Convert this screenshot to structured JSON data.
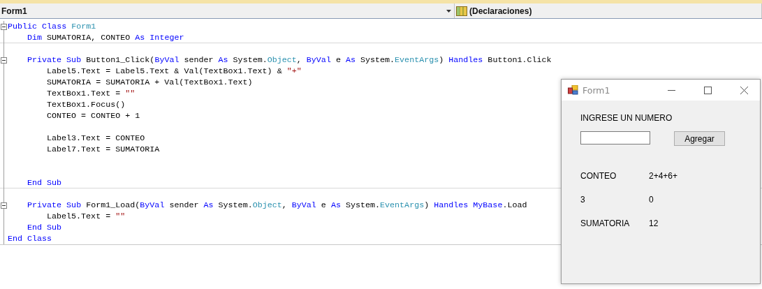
{
  "editor": {
    "class_dropdown": "Form1",
    "member_dropdown": "(Declaraciones)",
    "code": [
      {
        "kind": "code",
        "expanded": true,
        "tokens": [
          {
            "kind": "keyword",
            "text": "Public Class "
          },
          {
            "kind": "type",
            "text": "Form1"
          }
        ],
        "children": [
          {
            "kind": "code",
            "separator_after": true,
            "tokens": [
              {
                "kind": "keyword",
                "text": "Dim "
              },
              {
                "kind": "plain",
                "text": "SUMATORIA, CONTEO "
              },
              {
                "kind": "keyword",
                "text": "As Integer"
              }
            ]
          },
          {
            "kind": "blank"
          },
          {
            "kind": "code",
            "expanded": true,
            "tokens": [
              {
                "kind": "keyword",
                "text": "Private Sub "
              },
              {
                "kind": "plain",
                "text": "Button1_Click("
              },
              {
                "kind": "keyword",
                "text": "ByVal"
              },
              {
                "kind": "plain",
                "text": " sender "
              },
              {
                "kind": "keyword",
                "text": "As"
              },
              {
                "kind": "plain",
                "text": " System."
              },
              {
                "kind": "type",
                "text": "Object"
              },
              {
                "kind": "plain",
                "text": ", "
              },
              {
                "kind": "keyword",
                "text": "ByVal"
              },
              {
                "kind": "plain",
                "text": " e "
              },
              {
                "kind": "keyword",
                "text": "As"
              },
              {
                "kind": "plain",
                "text": " System."
              },
              {
                "kind": "type",
                "text": "EventArgs"
              },
              {
                "kind": "plain",
                "text": ") "
              },
              {
                "kind": "keyword",
                "text": "Handles"
              },
              {
                "kind": "plain",
                "text": " Button1.Click"
              }
            ],
            "children": [
              {
                "kind": "code",
                "tokens": [
                  {
                    "kind": "plain",
                    "text": "Label5.Text = Label5.Text & Val(TextBox1.Text) & "
                  },
                  {
                    "kind": "string",
                    "text": "\"+\""
                  }
                ]
              },
              {
                "kind": "code",
                "tokens": [
                  {
                    "kind": "plain",
                    "text": "SUMATORIA = SUMATORIA + Val(TextBox1.Text)"
                  }
                ]
              },
              {
                "kind": "code",
                "tokens": [
                  {
                    "kind": "plain",
                    "text": "TextBox1.Text = "
                  },
                  {
                    "kind": "string",
                    "text": "\"\""
                  }
                ]
              },
              {
                "kind": "code",
                "tokens": [
                  {
                    "kind": "plain",
                    "text": "TextBox1.Focus()"
                  }
                ]
              },
              {
                "kind": "code",
                "tokens": [
                  {
                    "kind": "plain",
                    "text": "CONTEO = CONTEO + 1"
                  }
                ]
              },
              {
                "kind": "blank"
              },
              {
                "kind": "code",
                "tokens": [
                  {
                    "kind": "plain",
                    "text": "Label3.Text = CONTEO"
                  }
                ]
              },
              {
                "kind": "code",
                "tokens": [
                  {
                    "kind": "plain",
                    "text": "Label7.Text = SUMATORIA"
                  }
                ]
              },
              {
                "kind": "blank"
              },
              {
                "kind": "blank"
              }
            ]
          },
          {
            "kind": "code",
            "separator_after": true,
            "tokens": [
              {
                "kind": "keyword",
                "text": "End Sub"
              }
            ]
          },
          {
            "kind": "blank"
          },
          {
            "kind": "code",
            "expanded": true,
            "tokens": [
              {
                "kind": "keyword",
                "text": "Private Sub "
              },
              {
                "kind": "plain",
                "text": "Form1_Load("
              },
              {
                "kind": "keyword",
                "text": "ByVal"
              },
              {
                "kind": "plain",
                "text": " sender "
              },
              {
                "kind": "keyword",
                "text": "As"
              },
              {
                "kind": "plain",
                "text": " System."
              },
              {
                "kind": "type",
                "text": "Object"
              },
              {
                "kind": "plain",
                "text": ", "
              },
              {
                "kind": "keyword",
                "text": "ByVal"
              },
              {
                "kind": "plain",
                "text": " e "
              },
              {
                "kind": "keyword",
                "text": "As"
              },
              {
                "kind": "plain",
                "text": " System."
              },
              {
                "kind": "type",
                "text": "EventArgs"
              },
              {
                "kind": "plain",
                "text": ") "
              },
              {
                "kind": "keyword",
                "text": "Handles MyBase"
              },
              {
                "kind": "plain",
                "text": ".Load"
              }
            ],
            "children": [
              {
                "kind": "code",
                "tokens": [
                  {
                    "kind": "plain",
                    "text": "Label5.Text = "
                  },
                  {
                    "kind": "string",
                    "text": "\"\""
                  }
                ]
              }
            ]
          },
          {
            "kind": "code",
            "tokens": [
              {
                "kind": "keyword",
                "text": "End Sub"
              }
            ]
          }
        ]
      },
      {
        "kind": "code",
        "tokens": [
          {
            "kind": "keyword",
            "text": "End Class"
          }
        ]
      }
    ]
  },
  "form_window": {
    "title": "Form1",
    "prompt": "INGRESE UN NUMERO",
    "button": "Agregar",
    "grid": [
      [
        "CONTEO",
        "2+4+6+"
      ],
      [
        "3",
        "0"
      ],
      [
        "SUMATORIA",
        "12"
      ]
    ]
  }
}
